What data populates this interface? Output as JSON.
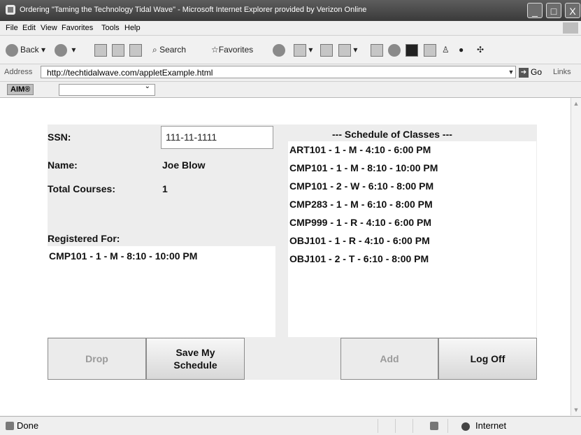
{
  "window": {
    "title": "Ordering \"Taming the Technology Tidal Wave\" - Microsoft Internet Explorer provided by Verizon Online",
    "controls": [
      "_",
      "□",
      "X"
    ]
  },
  "menu": [
    "File",
    "Edit",
    "View",
    "Favorites",
    "Tools",
    "Help"
  ],
  "toolbar": {
    "back": "Back",
    "search": "Search",
    "favorites": "Favorites"
  },
  "address": {
    "label": "Address",
    "url": "http://techtidalwave.com/appletExample.html",
    "go": "Go",
    "links": "Links"
  },
  "aim": {
    "label": "AIM®"
  },
  "applet": {
    "ssn_label": "SSN:",
    "ssn_value": "111-11-1111",
    "name_label": "Name:",
    "name_value": "Joe Blow",
    "total_label": "Total Courses:",
    "total_value": "1",
    "registered_label": "Registered For:",
    "registered": [
      "CMP101 - 1 - M - 8:10 - 10:00 PM"
    ],
    "schedule_title": "--- Schedule of Classes ---",
    "schedule": [
      "ART101 - 1 - M - 4:10 - 6:00 PM",
      "CMP101 - 1 - M - 8:10 - 10:00 PM",
      "CMP101 - 2 - W - 6:10 - 8:00 PM",
      "CMP283 - 1 - M - 6:10 - 8:00 PM",
      "CMP999 - 1 - R - 4:10 - 6:00 PM",
      "OBJ101 - 1 - R - 4:10 - 6:00 PM",
      "OBJ101 - 2 - T - 6:10 - 8:00 PM"
    ],
    "buttons": {
      "drop": "Drop",
      "save_line1": "Save My",
      "save_line2": "Schedule",
      "add": "Add",
      "logoff": "Log Off"
    }
  },
  "status": {
    "text": "Done",
    "zone": "Internet"
  }
}
